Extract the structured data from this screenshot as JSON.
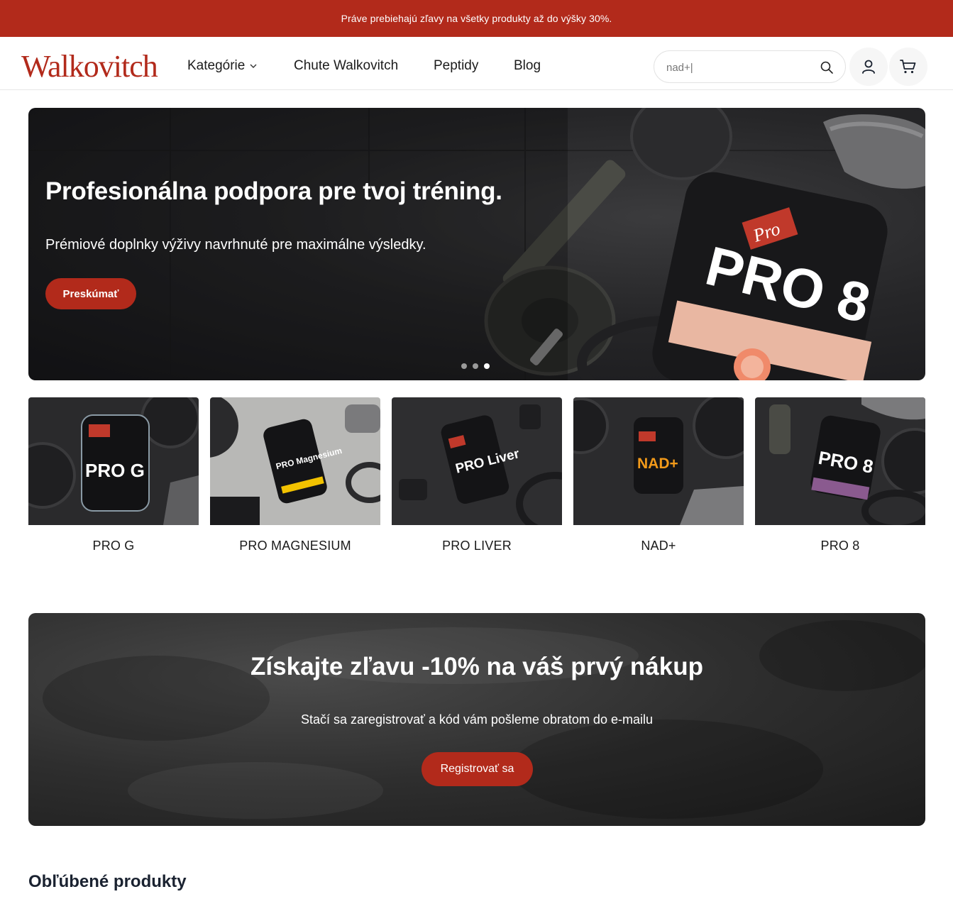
{
  "promo_bar": {
    "text": "Práve prebiehajú zľavy na všetky produkty až do výšky 30%."
  },
  "header": {
    "logo_text": "Walkovitch",
    "nav": [
      {
        "label": "Kategórie"
      },
      {
        "label": "Chute Walkovitch"
      },
      {
        "label": "Peptidy"
      },
      {
        "label": "Blog"
      }
    ],
    "search": {
      "value": "nad+|",
      "placeholder": ""
    }
  },
  "hero": {
    "title": "Profesionálna podpora pre tvoj tréning.",
    "subtitle": "Prémiové doplnky výživy navrhnuté pre maximálne výsledky.",
    "button": "Preskúmať",
    "product_brand": "Pro",
    "product_label": "PRO 8",
    "slides": 3,
    "active_slide": 3
  },
  "products": [
    {
      "name": "PRO G",
      "jar_text": "PRO G",
      "accent": "#8cc63f"
    },
    {
      "name": "PRO MAGNESIUM",
      "jar_text": "PRO Magnesium",
      "accent": "#f2c200"
    },
    {
      "name": "PRO LIVER",
      "jar_text": "PRO Liver",
      "accent": "#e0463a"
    },
    {
      "name": "NAD+",
      "jar_text": "NAD+",
      "accent": "#f29a1a"
    },
    {
      "name": "PRO 8",
      "jar_text": "PRO 8",
      "accent": "#e2d400"
    }
  ],
  "discount": {
    "title": "Získajte zľavu -10% na váš prvý nákup",
    "subtitle": "Stačí sa zaregistrovať a kód vám pošleme obratom do e-mailu",
    "button": "Registrovať sa"
  },
  "popular": {
    "title": "Obľúbené produkty"
  },
  "colors": {
    "brand_red": "#b22a1b",
    "text_dark": "#1a2230"
  }
}
